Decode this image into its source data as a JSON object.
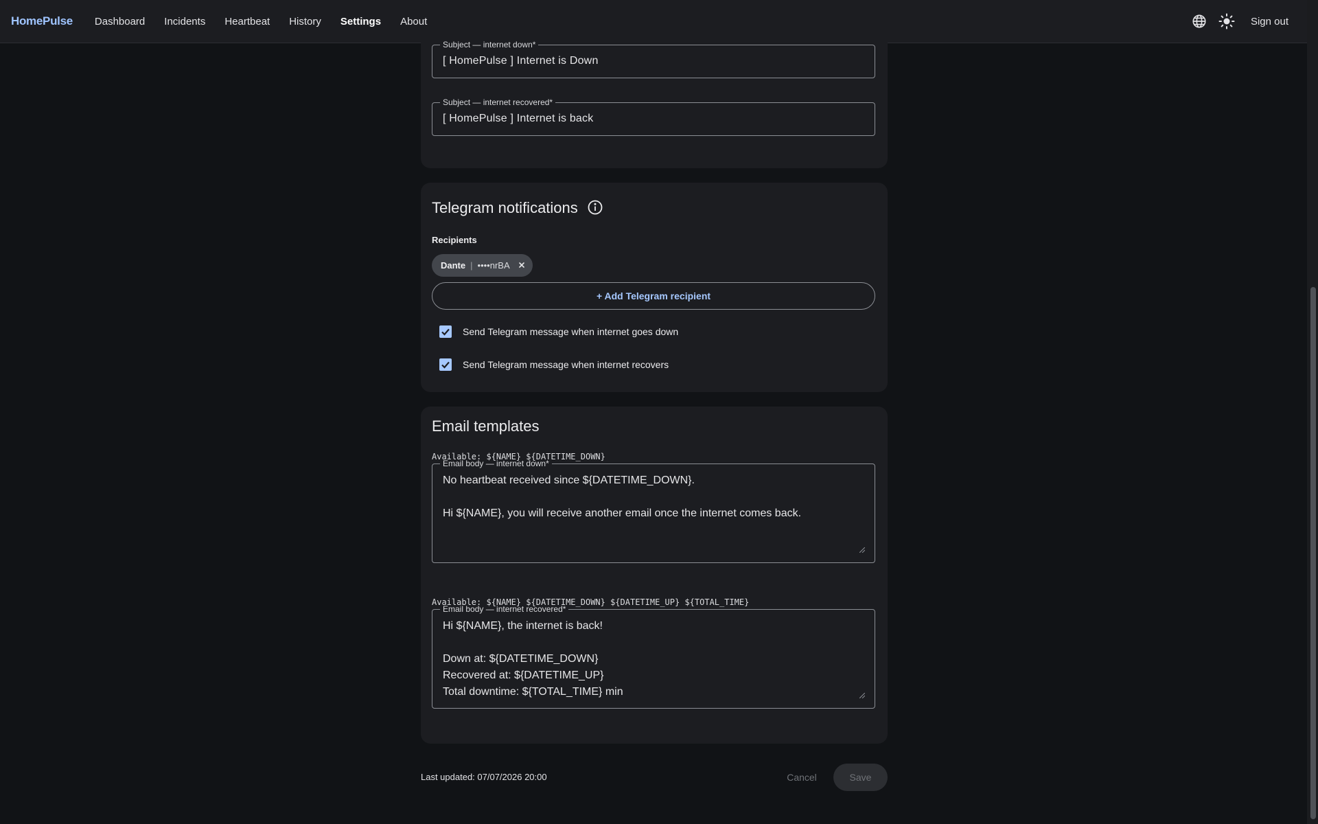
{
  "app": {
    "brand": "HomePulse"
  },
  "nav": {
    "items": [
      {
        "label": "Dashboard"
      },
      {
        "label": "Incidents"
      },
      {
        "label": "Heartbeat"
      },
      {
        "label": "History"
      },
      {
        "label": "Settings"
      },
      {
        "label": "About"
      }
    ],
    "active": "Settings",
    "sign_out": "Sign out"
  },
  "email_subjects": {
    "down": {
      "label": "Subject — internet down*",
      "value": "[ HomePulse ] Internet is Down"
    },
    "recovered": {
      "label": "Subject — internet recovered*",
      "value": "[ HomePulse ] Internet is back"
    }
  },
  "telegram": {
    "title": "Telegram notifications",
    "recipients_label": "Recipients",
    "recipients": [
      {
        "name": "Dante",
        "separator": "|",
        "token": "••••nrBA"
      }
    ],
    "add_button": "+ Add Telegram recipient",
    "options": [
      {
        "label": "Send Telegram message when internet goes down",
        "checked": true
      },
      {
        "label": "Send Telegram message when internet recovers",
        "checked": true
      }
    ]
  },
  "templates": {
    "title": "Email templates",
    "down": {
      "available": "Available: ${NAME} ${DATETIME_DOWN}",
      "label": "Email body — internet down*",
      "value": "No heartbeat received since ${DATETIME_DOWN}.\n\nHi ${NAME}, you will receive another email once the internet comes back."
    },
    "recovered": {
      "available": "Available: ${NAME} ${DATETIME_DOWN} ${DATETIME_UP} ${TOTAL_TIME}",
      "label": "Email body — internet recovered*",
      "value": "Hi ${NAME}, the internet is back!\n\nDown at: ${DATETIME_DOWN}\nRecovered at: ${DATETIME_UP}\nTotal downtime: ${TOTAL_TIME} min"
    }
  },
  "footer": {
    "last_updated": "Last updated: 07/07/2026 20:00",
    "cancel": "Cancel",
    "save": "Save"
  },
  "colors": {
    "accent": "#a6c8ff",
    "brand": "#9fc4ff",
    "background": "#111316",
    "surface": "#1c1d21"
  },
  "icons": {
    "language": "globe-icon",
    "theme": "sun-icon",
    "info": "info-icon",
    "remove": "close-icon",
    "check": "check-icon"
  }
}
